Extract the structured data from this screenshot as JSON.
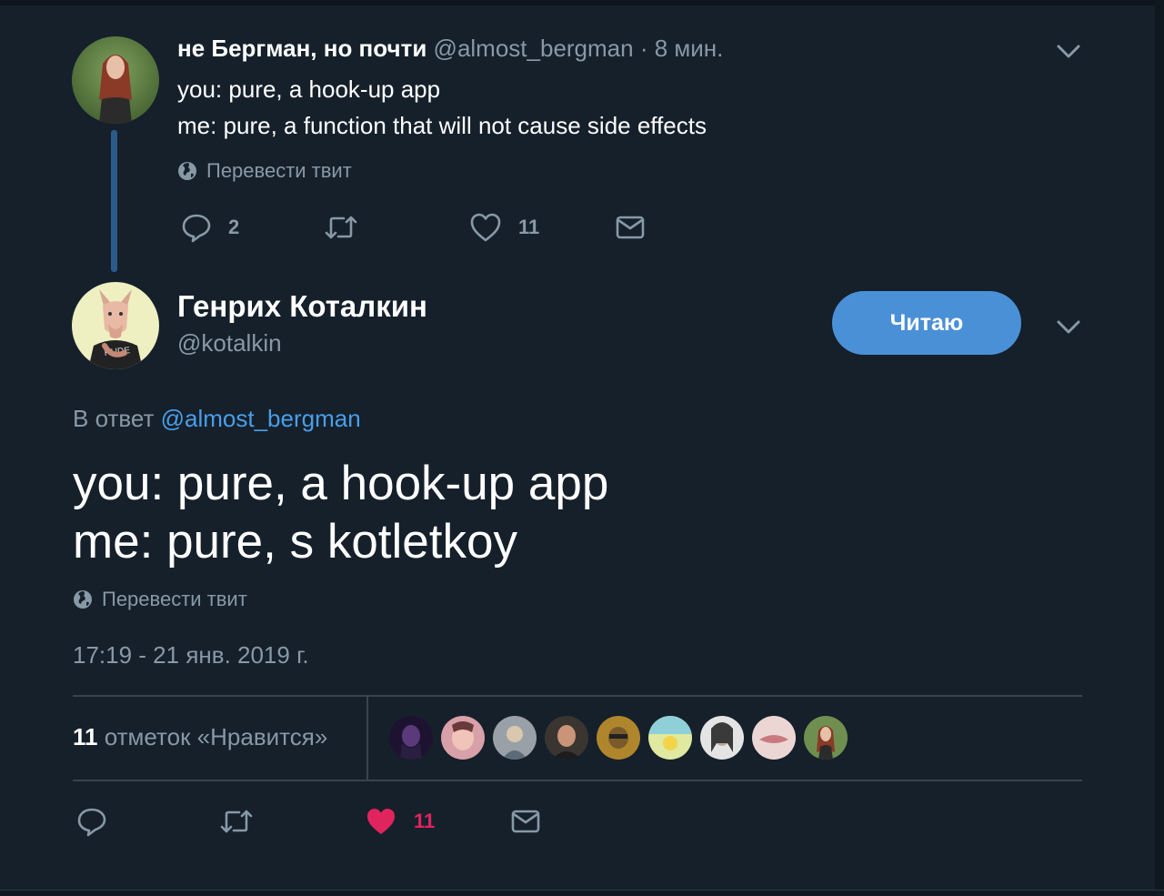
{
  "colors": {
    "background": "#15202b",
    "accent": "#4a90d6",
    "link": "#4a9ee8",
    "secondary_text": "#8899a6",
    "like": "#e0245e",
    "divider": "#38444d"
  },
  "parent_tweet": {
    "display_name": "не Бергман, но почти",
    "handle": "@almost_bergman",
    "time": "· 8 мин.",
    "lines": [
      "you: pure, a hook-up app",
      "me: pure, a function that will not cause side effects"
    ],
    "translate_label": "Перевести твит",
    "actions": {
      "reply_count": "2",
      "retweet_count": "",
      "like_count": "11"
    },
    "icons": {
      "menu": "chevron-down-icon",
      "reply": "reply-bubble-icon",
      "retweet": "retweet-icon",
      "like": "heart-outline-icon",
      "dm": "envelope-icon",
      "translate": "globe-icon"
    }
  },
  "main_tweet": {
    "display_name": "Генрих Коталкин",
    "handle": "@kotalkin",
    "follow_label": "Читаю",
    "reply_prefix": "В ответ",
    "reply_to": "@almost_bergman",
    "avatar_shirt_text": "RUDE",
    "lines": [
      "you: pure, a hook-up app",
      "me: pure, s kotletkoy"
    ],
    "translate_label": "Перевести твит",
    "timestamp": "17:19 - 21 янв. 2019 г.",
    "likes": {
      "count": "11",
      "label": "отметок «Нравится»"
    },
    "likers_count": 9,
    "actions": {
      "like_count": "11",
      "liked": true
    },
    "icons": {
      "menu": "chevron-down-icon",
      "reply": "reply-bubble-icon",
      "retweet": "retweet-icon",
      "like": "heart-filled-icon",
      "dm": "envelope-icon",
      "translate": "globe-icon"
    }
  }
}
